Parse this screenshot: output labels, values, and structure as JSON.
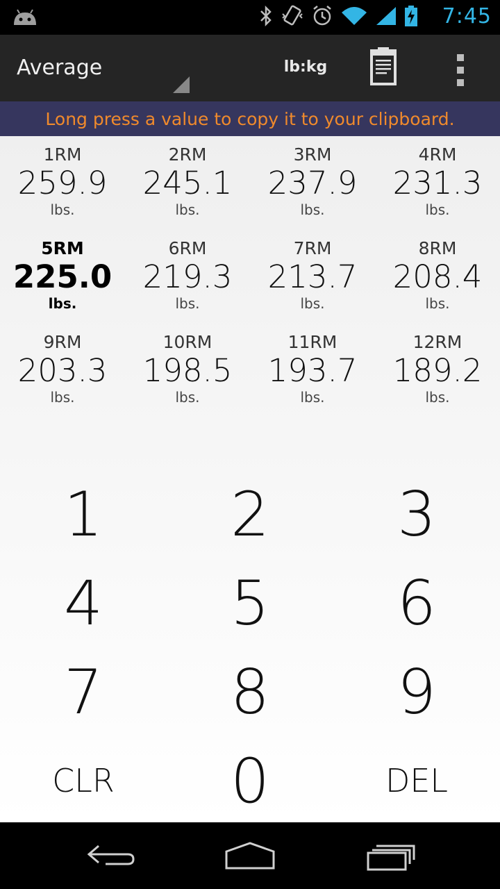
{
  "status_bar": {
    "time": "7:45",
    "icons": [
      "android-icon",
      "bluetooth-icon",
      "vibrate-icon",
      "alarm-icon",
      "wifi-icon",
      "signal-icon",
      "battery-charging-icon"
    ],
    "accent": "#33b5e5"
  },
  "action_bar": {
    "mode_label": "Average",
    "unit_toggle": "lb:kg",
    "icons": [
      "clipboard-icon",
      "overflow-menu-icon"
    ]
  },
  "banner": {
    "text": "Long press a value to copy it to your clipboard.",
    "text_color": "#f08a2c",
    "background": "#36365e"
  },
  "rm_table": {
    "rows": [
      [
        {
          "label": "1RM",
          "value": "259.9",
          "unit": "lbs."
        },
        {
          "label": "2RM",
          "value": "245.1",
          "unit": "lbs."
        },
        {
          "label": "3RM",
          "value": "237.9",
          "unit": "lbs."
        },
        {
          "label": "4RM",
          "value": "231.3",
          "unit": "lbs."
        }
      ],
      [
        {
          "label": "5RM",
          "value": "225.0",
          "unit": "lbs."
        },
        {
          "label": "6RM",
          "value": "219.3",
          "unit": "lbs."
        },
        {
          "label": "7RM",
          "value": "213.7",
          "unit": "lbs."
        },
        {
          "label": "8RM",
          "value": "208.4",
          "unit": "lbs."
        }
      ],
      [
        {
          "label": "9RM",
          "value": "203.3",
          "unit": "lbs."
        },
        {
          "label": "10RM",
          "value": "198.5",
          "unit": "lbs."
        },
        {
          "label": "11RM",
          "value": "193.7",
          "unit": "lbs."
        },
        {
          "label": "12RM",
          "value": "189.2",
          "unit": "lbs."
        }
      ]
    ],
    "selected": "5RM"
  },
  "keypad": {
    "rows": [
      [
        "1",
        "2",
        "3"
      ],
      [
        "4",
        "5",
        "6"
      ],
      [
        "7",
        "8",
        "9"
      ],
      [
        "CLR",
        "0",
        "DEL"
      ]
    ]
  },
  "nav_bar": {
    "icons": [
      "back-icon",
      "home-icon",
      "recent-apps-icon"
    ]
  }
}
